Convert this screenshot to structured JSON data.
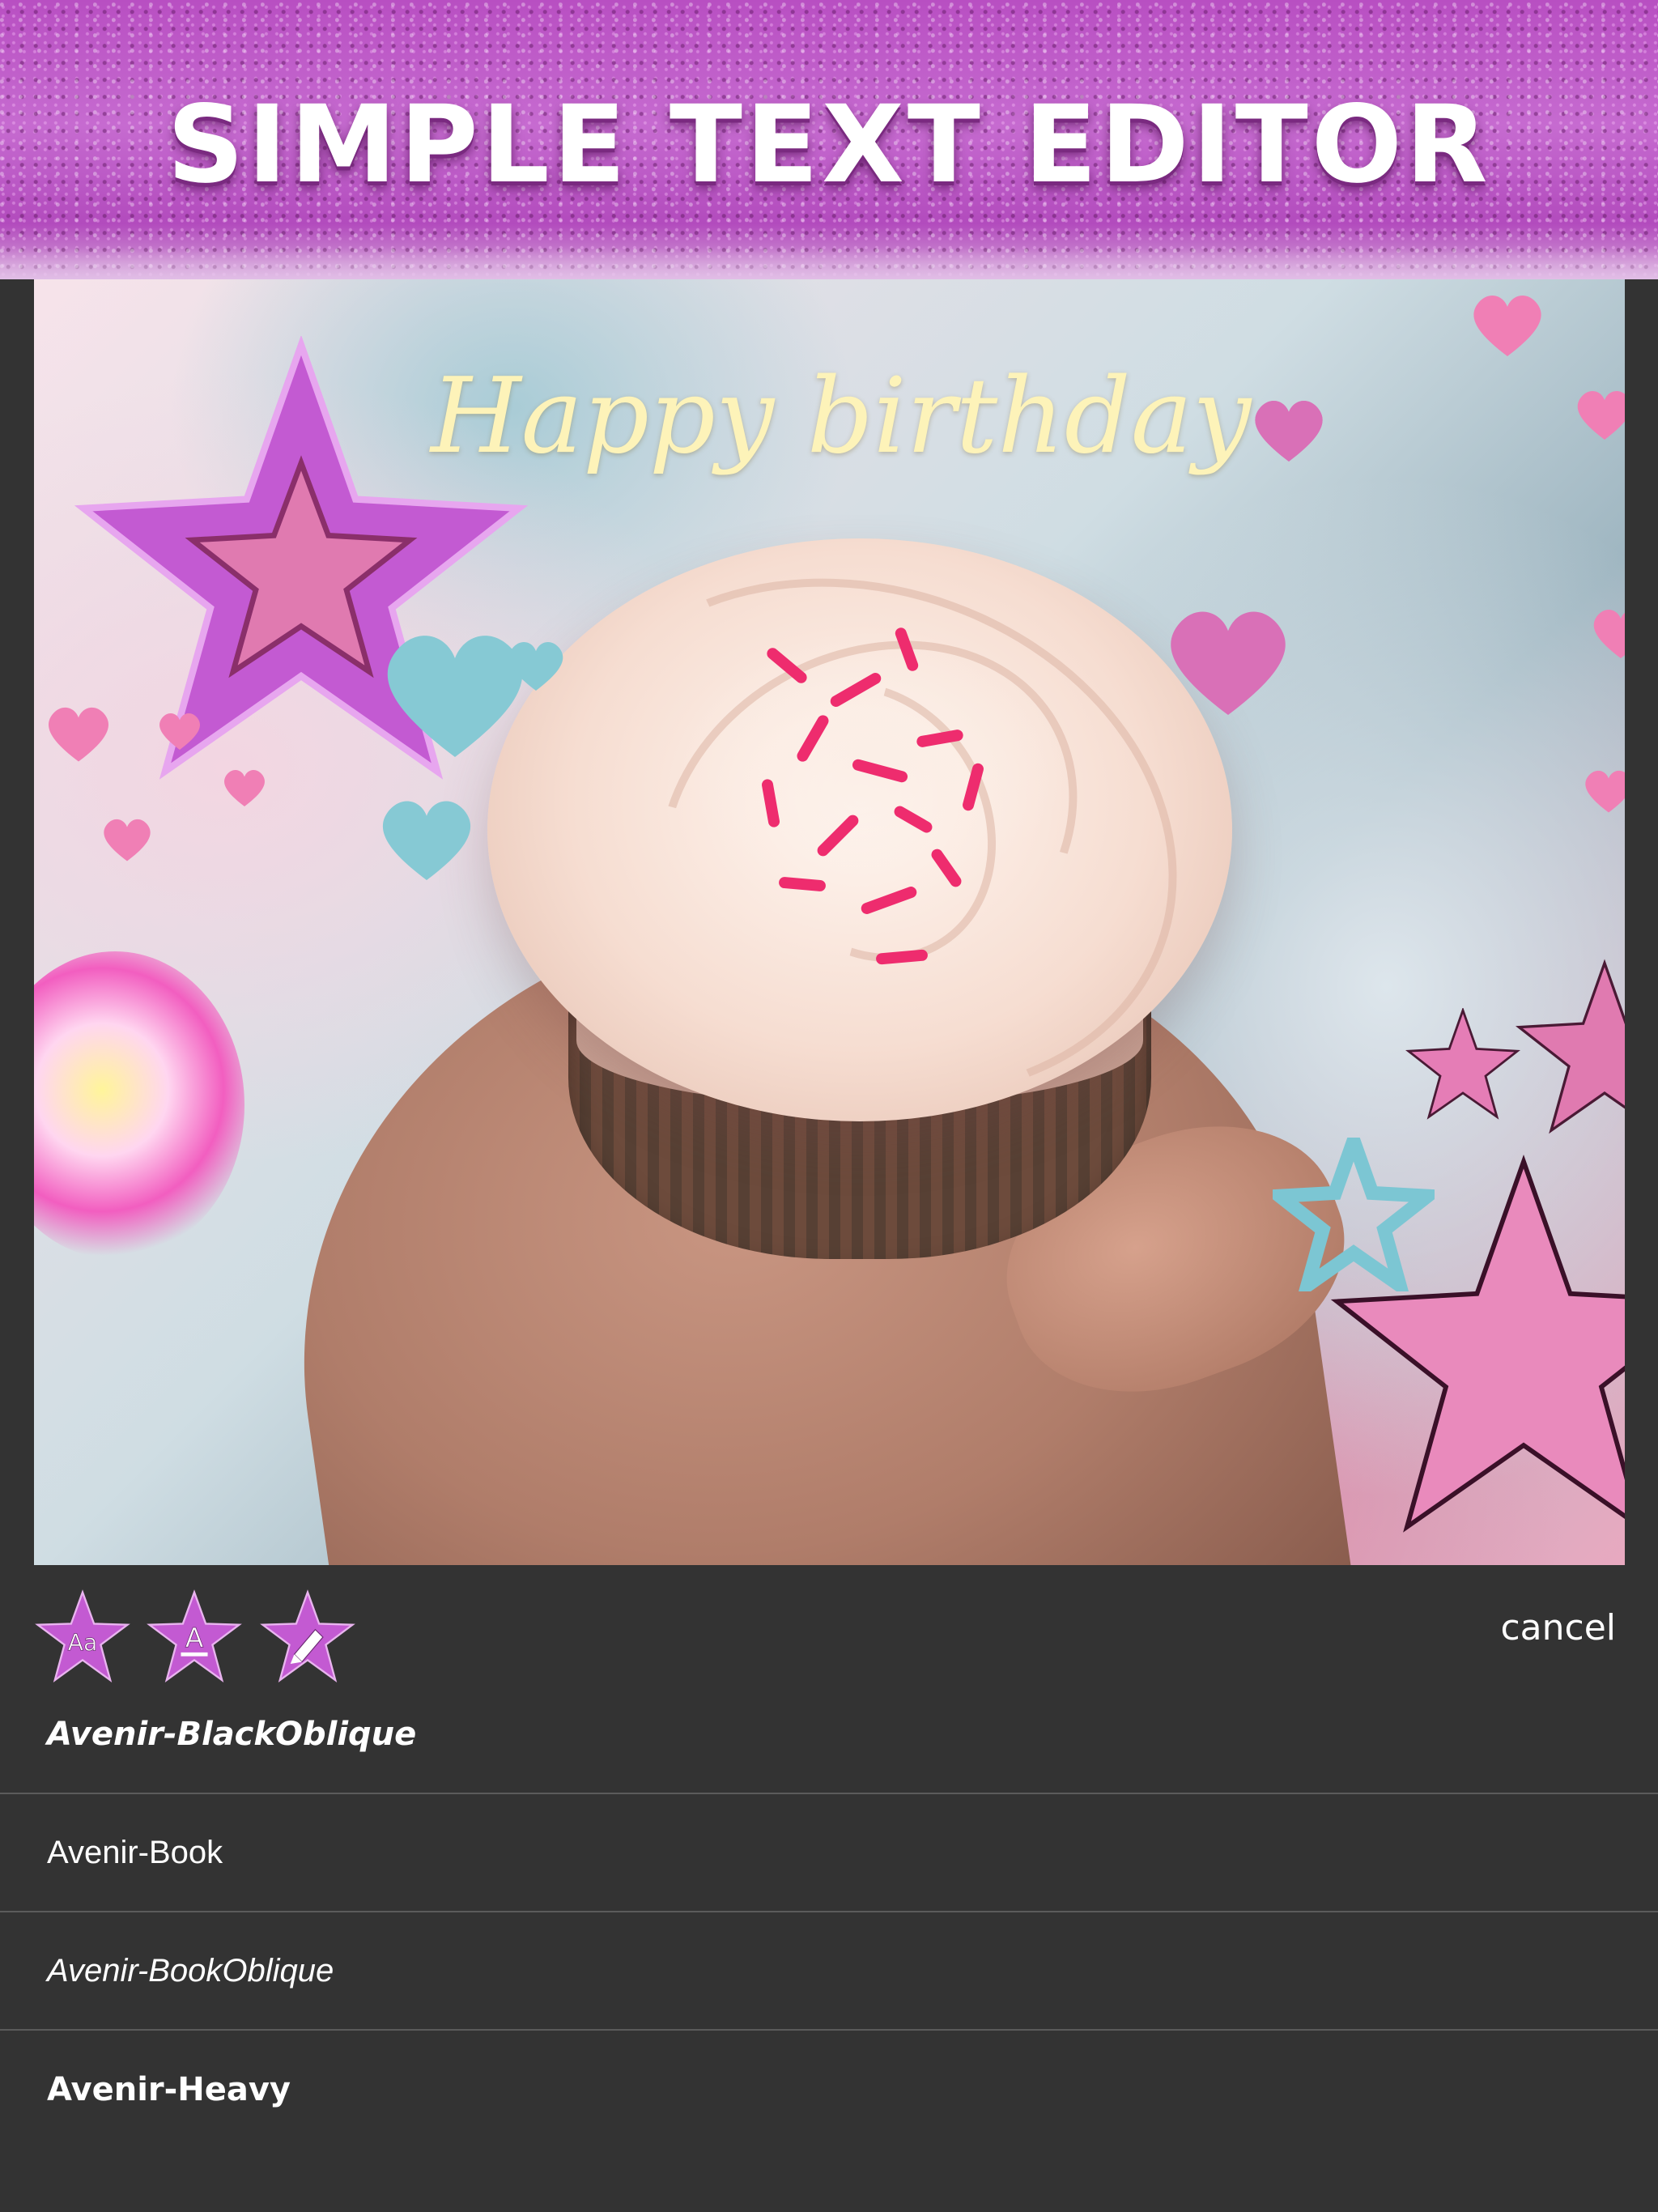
{
  "header": {
    "title": "SIMPLE TEXT EDITOR"
  },
  "canvas": {
    "overlay_text": "Happy birthday",
    "overlay_text_color": "#fdf3b9"
  },
  "toolbar": {
    "tools": [
      {
        "icon": "font-icon",
        "glyph": "Aa"
      },
      {
        "icon": "text-color-icon",
        "glyph": "A"
      },
      {
        "icon": "highlighter-icon",
        "glyph": "✎"
      }
    ],
    "cancel_label": "cancel"
  },
  "font_list": {
    "items": [
      {
        "label": "Avenir-BlackOblique"
      },
      {
        "label": "Avenir-Book"
      },
      {
        "label": "Avenir-BookOblique"
      },
      {
        "label": "Avenir-Heavy"
      }
    ]
  },
  "colors": {
    "banner": "#c066cb",
    "background": "#333333",
    "star_purple": "#c35ad2",
    "star_pink": "#e07ab0",
    "star_cyan": "#7cc6d3"
  }
}
